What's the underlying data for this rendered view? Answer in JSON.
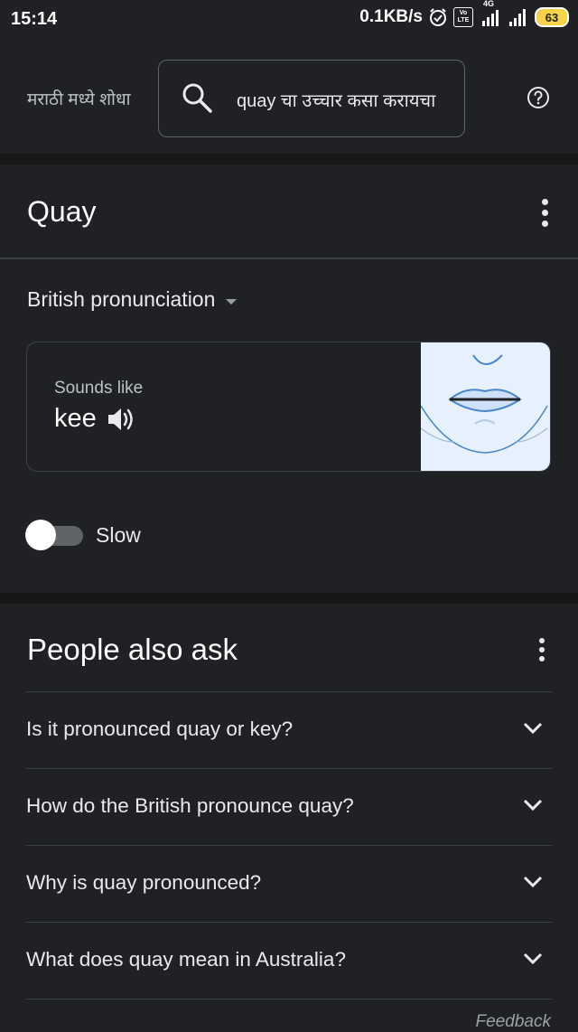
{
  "status_bar": {
    "time": "15:14",
    "speed": "0.1KB/s",
    "network": "4G",
    "volte_top": "Vo",
    "volte_bottom": "LTE",
    "battery": "63"
  },
  "search": {
    "lang_label": "मराठी मध्ये शोधा",
    "query": "quay चा उच्चार कसा करायचा",
    "search_icon": "search-icon",
    "help_icon": "help-icon"
  },
  "pronunciation": {
    "word": "Quay",
    "accent": "British pronunciation",
    "sounds_like_label": "Sounds like",
    "phonetic": "kee",
    "speaker_icon": "speaker-icon",
    "slow_label": "Slow",
    "slow_enabled": false
  },
  "people_also_ask": {
    "title": "People also ask",
    "questions": [
      "Is it pronounced quay or key?",
      "How do the British pronounce quay?",
      "Why is quay pronounced?",
      "What does quay mean in Australia?"
    ],
    "feedback": "Feedback"
  },
  "colors": {
    "background": "#202124",
    "divider": "#3c4043",
    "text": "#e8eaed",
    "lips_background": "#e7f0fe",
    "lips_stroke": "#4a86c8"
  }
}
